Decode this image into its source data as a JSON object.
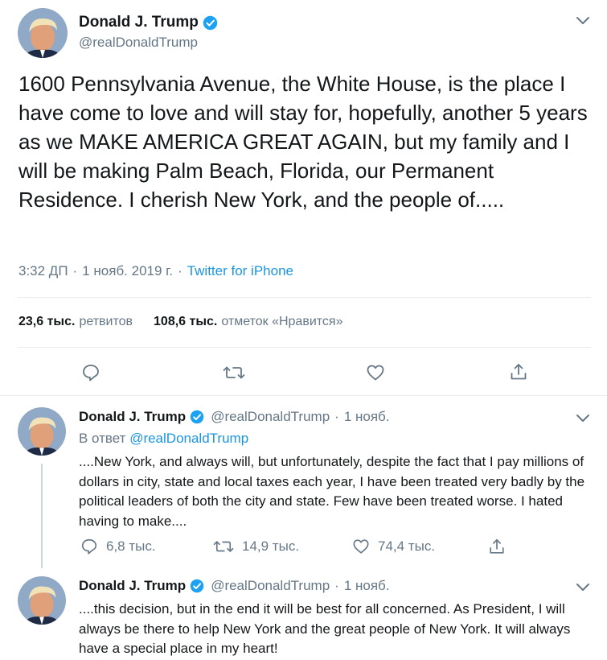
{
  "main": {
    "name": "Donald J. Trump",
    "handle": "@realDonaldTrump",
    "text": "1600 Pennsylvania Avenue, the White House, is the place I have come to love and will stay for, hopefully, another 5 years as we MAKE AMERICA GREAT AGAIN, but my family and I will be making Palm Beach, Florida, our Permanent Residence. I cherish New York, and the people of.....",
    "time": "3:32 ДП",
    "date": "1 нояб. 2019 г.",
    "source": "Twitter for iPhone",
    "retweets_count": "23,6 тыс.",
    "retweets_label": "ретвитов",
    "likes_count": "108,6 тыс.",
    "likes_label": "отметок «Нравится»"
  },
  "replies": [
    {
      "name": "Donald J. Trump",
      "handle": "@realDonaldTrump",
      "date": "1 нояб.",
      "in_reply_label": "В ответ",
      "in_reply_handle": "@realDonaldTrump",
      "text": "....New York, and always will, but unfortunately, despite the fact that I pay millions of dollars in city, state and local taxes each year, I have been treated very badly by the political leaders of both the city and state. Few have been treated worse. I hated having to make....",
      "reply_count": "6,8 тыс.",
      "retweet_count": "14,9 тыс.",
      "like_count": "74,4 тыс."
    },
    {
      "name": "Donald J. Trump",
      "handle": "@realDonaldTrump",
      "date": "1 нояб.",
      "text": "....this decision, but in the end it will be best for all concerned. As President, I will always be there to help New York and the great people of New York. It will always have a special place in my heart!"
    }
  ],
  "colors": {
    "verified": "#1da1f2",
    "link": "#1b95e0",
    "secondary_text": "#657786",
    "divider": "#e6ecf0"
  },
  "icons": {
    "verified": "verified-badge-icon",
    "menu": "chevron-down-icon",
    "reply": "reply-bubble-icon",
    "retweet": "retweet-icon",
    "like": "heart-icon",
    "share": "share-icon"
  }
}
